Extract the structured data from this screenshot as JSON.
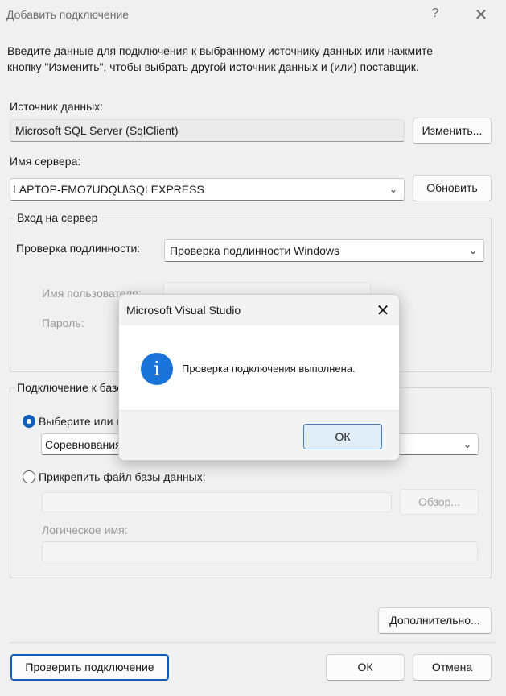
{
  "window": {
    "title": "Добавить подключение",
    "help_icon": "?",
    "close_icon": "✕"
  },
  "intro_line1": "Введите данные для подключения к выбранному источнику данных или нажмите",
  "intro_line2": "кнопку \"Изменить\", чтобы выбрать другой источник данных и (или) поставщик.",
  "datasource": {
    "label": "Источник данных:",
    "value": "Microsoft SQL Server (SqlClient)",
    "change_button": "Изменить..."
  },
  "server": {
    "label": "Имя сервера:",
    "value": "LAPTOP-FMO7UDQU\\SQLEXPRESS",
    "refresh_button": "Обновить"
  },
  "login": {
    "group_title": "Вход на сервер",
    "auth_label": "Проверка подлинности:",
    "auth_value": "Проверка подлинности Windows",
    "username_label": "Имя пользователя:",
    "password_label": "Пароль:"
  },
  "db": {
    "group_title": "Подключение к базе данных",
    "select_label": "Выберите или введите имя базы данных:",
    "select_value": "Соревнования",
    "attach_label": "Прикрепить файл базы данных:",
    "browse_button": "Обзор...",
    "logical_name_label": "Логическое имя:"
  },
  "advanced_button": "Дополнительно...",
  "footer": {
    "test_button": "Проверить подключение",
    "ok_button": "ОК",
    "cancel_button": "Отмена"
  },
  "modal": {
    "title": "Microsoft Visual Studio",
    "close_icon": "✕",
    "info_icon": "i",
    "message": "Проверка подключения выполнена.",
    "ok_button": "ОК"
  },
  "colors": {
    "accent": "#0f5fb8",
    "info_icon": "#1a73d9"
  }
}
